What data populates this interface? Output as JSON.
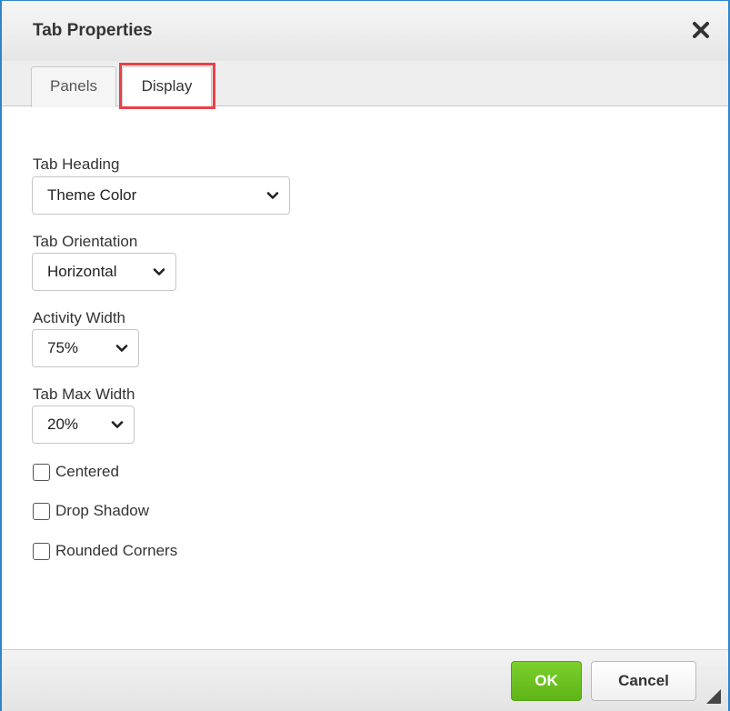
{
  "dialog": {
    "title": "Tab Properties",
    "close_icon": "close-icon"
  },
  "tabs": [
    {
      "label": "Panels",
      "active": false
    },
    {
      "label": "Display",
      "active": true
    }
  ],
  "highlight_color": "#e8414a",
  "fields": {
    "tab_heading": {
      "label": "Tab Heading",
      "value": "Theme Color"
    },
    "tab_orientation": {
      "label": "Tab Orientation",
      "value": "Horizontal"
    },
    "activity_width": {
      "label": "Activity Width",
      "value": "75%"
    },
    "tab_max_width": {
      "label": "Tab Max Width",
      "value": "20%"
    }
  },
  "checkboxes": [
    {
      "label": "Centered",
      "checked": false
    },
    {
      "label": "Drop Shadow",
      "checked": false
    },
    {
      "label": "Rounded Corners",
      "checked": false
    }
  ],
  "footer": {
    "ok_label": "OK",
    "cancel_label": "Cancel",
    "ok_color": "#6cc220"
  },
  "accent_border_color": "#2f86c6"
}
